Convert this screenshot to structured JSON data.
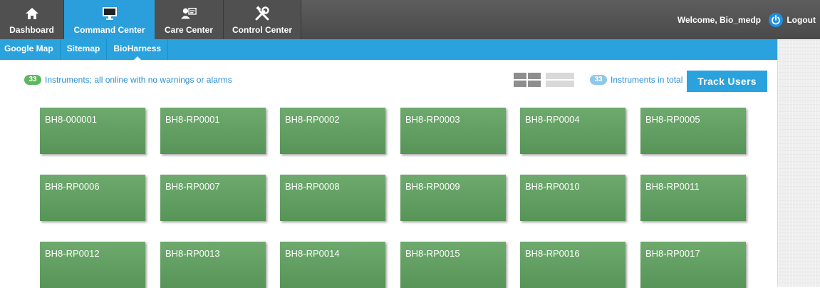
{
  "topnav": {
    "items": [
      {
        "label": "Dashboard",
        "icon": "home-icon"
      },
      {
        "label": "Command Center",
        "icon": "monitor-icon"
      },
      {
        "label": "Care Center",
        "icon": "user-card-icon"
      },
      {
        "label": "Control Center",
        "icon": "tools-icon"
      }
    ],
    "active": "Command Center",
    "welcome": "Welcome, Bio_medp",
    "logout": "Logout"
  },
  "subnav": {
    "items": [
      "Google Map",
      "Sitemap",
      "BioHarness"
    ],
    "active": "BioHarness"
  },
  "status": {
    "count": "33",
    "text": "Instruments; all online with no warnings or alarms"
  },
  "total": {
    "count": "33",
    "text": "Instruments in total"
  },
  "track_button": "Track Users",
  "instruments": [
    "BH8-000001",
    "BH8-RP0001",
    "BH8-RP0002",
    "BH8-RP0003",
    "BH8-RP0004",
    "BH8-RP0005",
    "BH8-RP0006",
    "BH8-RP0007",
    "BH8-RP0008",
    "BH8-RP0009",
    "BH8-RP0010",
    "BH8-RP0011",
    "BH8-RP0012",
    "BH8-RP0013",
    "BH8-RP0014",
    "BH8-RP0015",
    "BH8-RP0016",
    "BH8-RP0017"
  ],
  "colors": {
    "accent": "#2aa2de",
    "topbar": "#505050",
    "tile": "#62a062",
    "status_text": "#2b8fd6",
    "ok_badge": "#5cb85c"
  }
}
